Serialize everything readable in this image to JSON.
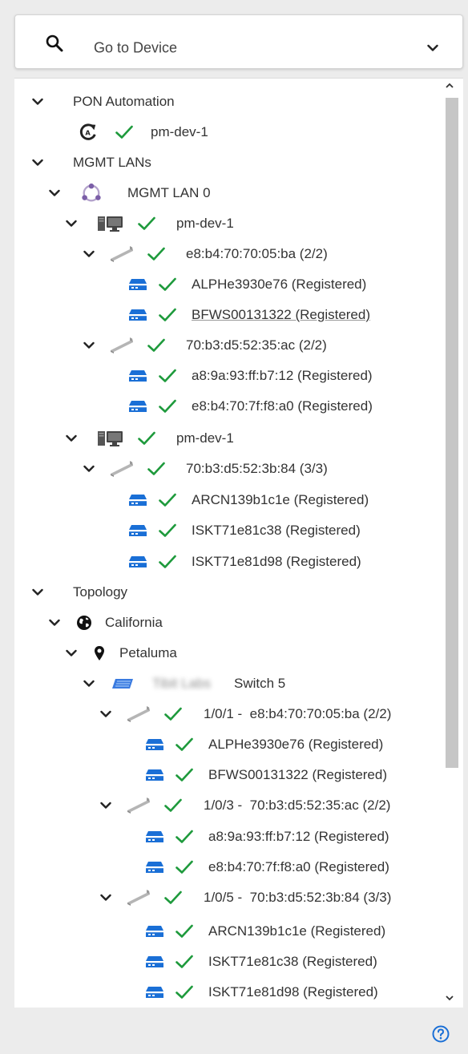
{
  "search": {
    "placeholder": "Go to Device"
  },
  "tree": {
    "pon_automation": {
      "label": "PON Automation",
      "child": "pm-dev-1"
    },
    "mgmt_lans": {
      "label": "MGMT LANs",
      "lan": "MGMT LAN 0",
      "dev1": "pm-dev-1",
      "olt1": "e8:b4:70:70:05:ba (2/2)",
      "olt1_onus": [
        "ALPHe3930e76 (Registered)",
        "BFWS00131322 (Registered)"
      ],
      "olt2": "70:b3:d5:52:35:ac (2/2)",
      "olt2_onus": [
        "a8:9a:93:ff:b7:12 (Registered)",
        "e8:b4:70:7f:f8:a0 (Registered)"
      ],
      "dev2": "pm-dev-1",
      "olt3": "70:b3:d5:52:3b:84 (3/3)",
      "olt3_onus": [
        "ARCN139b1c1e (Registered)",
        "ISKT71e81c38 (Registered)",
        "ISKT71e81d98 (Registered)"
      ]
    },
    "topology": {
      "label": "Topology",
      "region": "California",
      "site": "Petaluma",
      "switch_blurred": "Tibit Labs",
      "switch_label": "Switch 5",
      "port1": "1/0/1 -  e8:b4:70:70:05:ba (2/2)",
      "port1_onus": [
        "ALPHe3930e76 (Registered)",
        "BFWS00131322 (Registered)"
      ],
      "port2": "1/0/3 -  70:b3:d5:52:35:ac (2/2)",
      "port2_onus": [
        "a8:9a:93:ff:b7:12 (Registered)",
        "e8:b4:70:7f:f8:a0 (Registered)"
      ],
      "port3": "1/0/5 -  70:b3:d5:52:3b:84 (3/3)",
      "port3_onus": [
        "ARCN139b1c1e (Registered)",
        "ISKT71e81c38 (Registered)",
        "ISKT71e81d98 (Registered)"
      ]
    }
  },
  "colors": {
    "check": "#1e9a3c",
    "onu": "#1a6fd6",
    "lan": "#7b5ea7",
    "switch": "#3a7be0"
  }
}
